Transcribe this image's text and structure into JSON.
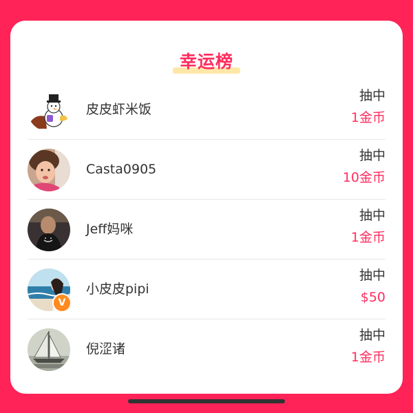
{
  "card": {
    "title": "幸运榜"
  },
  "list": [
    {
      "name": "皮皮虾米饭",
      "prize_label": "抽中",
      "prize_value": "1金币",
      "avatar_icon": "snowman-avatar-icon",
      "vip": false
    },
    {
      "name": "Casta0905",
      "prize_label": "抽中",
      "prize_value": "10金币",
      "avatar_icon": "child-photo-avatar-icon",
      "vip": false
    },
    {
      "name": "Jeff妈咪",
      "prize_label": "抽中",
      "prize_value": "1金币",
      "avatar_icon": "dark-photo-avatar-icon",
      "vip": false
    },
    {
      "name": "小皮皮pipi",
      "prize_label": "抽中",
      "prize_value": "$50",
      "avatar_icon": "beach-photo-avatar-icon",
      "vip": true,
      "vip_badge": "V"
    },
    {
      "name": "倪涩诸",
      "prize_label": "抽中",
      "prize_value": "1金币",
      "avatar_icon": "sailboat-photo-avatar-icon",
      "vip": false
    }
  ],
  "colors": {
    "background": "#ff2358",
    "accent": "#ff2d5e",
    "title_highlight": "#ffe7a8",
    "vip_badge": "#ff8a1e"
  }
}
